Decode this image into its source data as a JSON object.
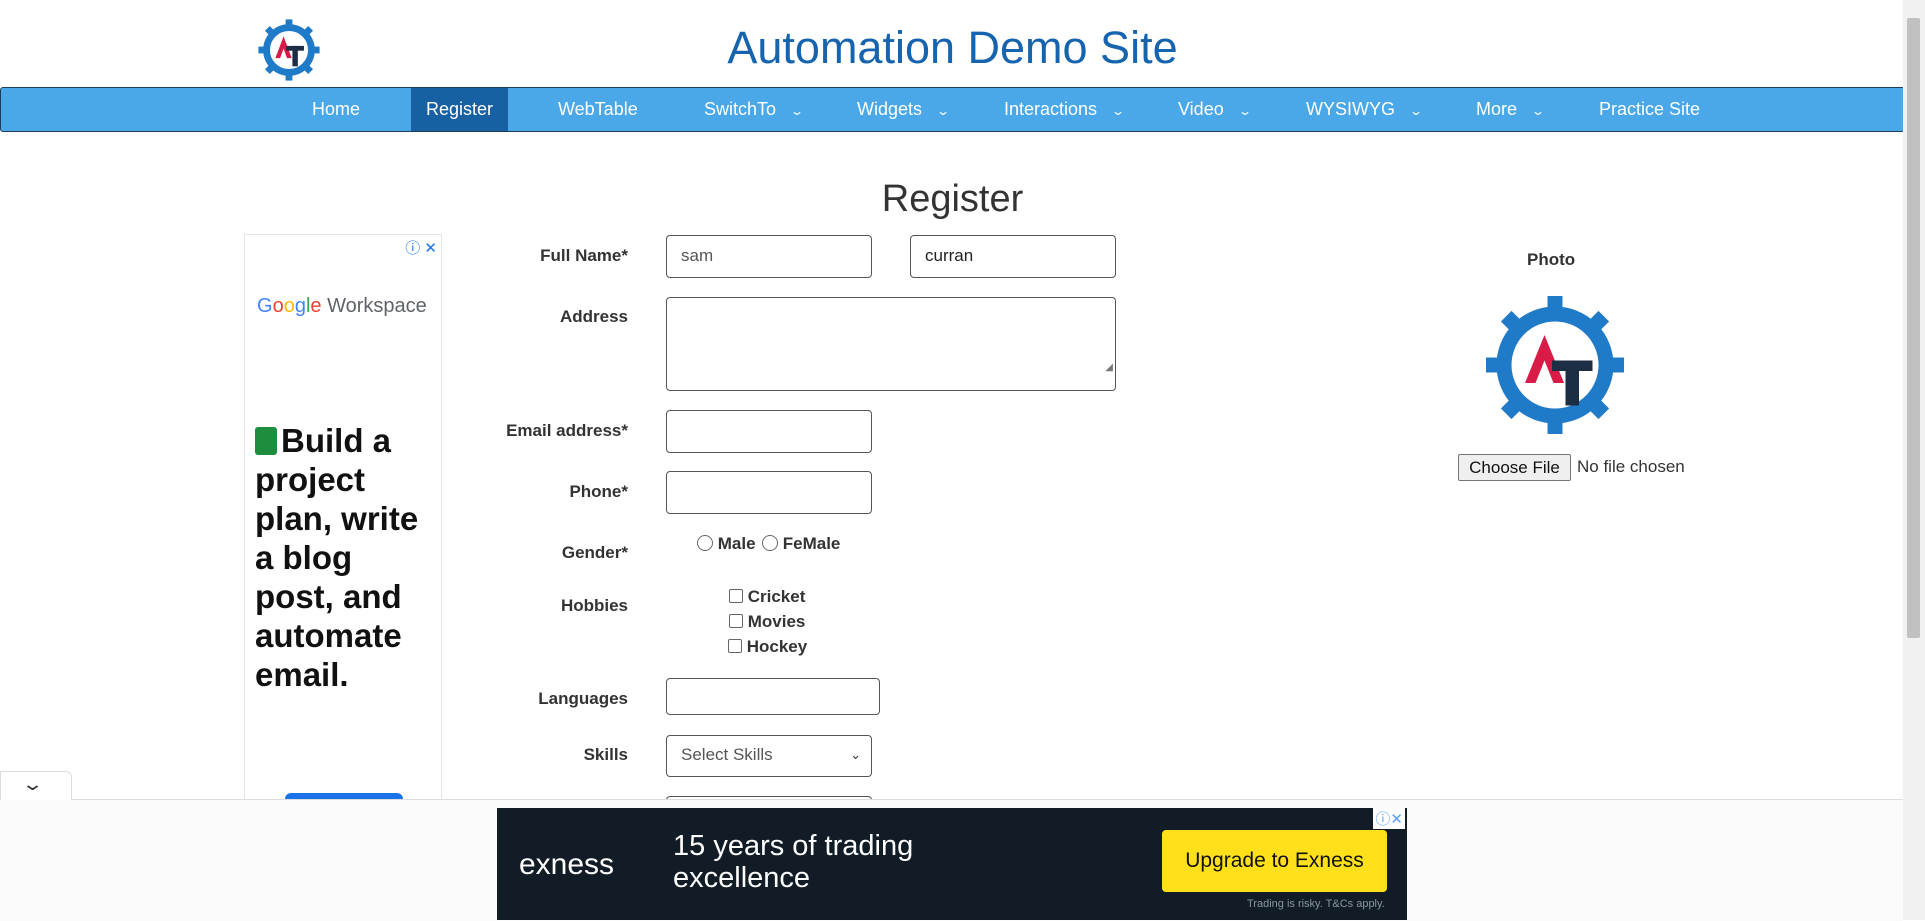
{
  "header": {
    "site_title": "Automation Demo Site"
  },
  "nav": {
    "items": [
      {
        "label": "Home"
      },
      {
        "label": "Register"
      },
      {
        "label": "WebTable"
      },
      {
        "label": "SwitchTo"
      },
      {
        "label": "Widgets"
      },
      {
        "label": "Interactions"
      },
      {
        "label": "Video"
      },
      {
        "label": "WYSIWYG"
      },
      {
        "label": "More"
      },
      {
        "label": "Practice Site"
      }
    ],
    "active": "Register",
    "dropdown_icon": "chevron-down-icon"
  },
  "page": {
    "title": "Register"
  },
  "form": {
    "full_name_label": "Full Name*",
    "first_name_value": "sam",
    "last_name_value": "curran",
    "address_label": "Address",
    "address_value": "",
    "email_label": "Email address*",
    "email_value": "",
    "phone_label": "Phone*",
    "phone_value": "",
    "gender_label": "Gender*",
    "gender_options": [
      "Male",
      "FeMale"
    ],
    "hobbies_label": "Hobbies",
    "hobbies": [
      "Cricket",
      "Movies",
      "Hockey"
    ],
    "languages_label": "Languages",
    "languages_value": "",
    "skills_label": "Skills",
    "skills_selected": "Select Skills"
  },
  "photo": {
    "label": "Photo",
    "choose_button": "Choose File",
    "status": "No file chosen"
  },
  "ads": {
    "left": {
      "brand": "Google Workspace",
      "headline": "Build a project plan, write a blog post, and automate email."
    },
    "bottom": {
      "brand": "exness",
      "text": "15 years of trading excellence",
      "button": "Upgrade to Exness",
      "fine_print": "Trading is risky. T&Cs apply."
    },
    "info_icon": "info-icon",
    "close_icon": "close-icon"
  },
  "colors": {
    "nav_bg": "#4aa8e8",
    "nav_active": "#1860a4",
    "title": "#1564ad",
    "exness_button": "#ffe01b"
  }
}
